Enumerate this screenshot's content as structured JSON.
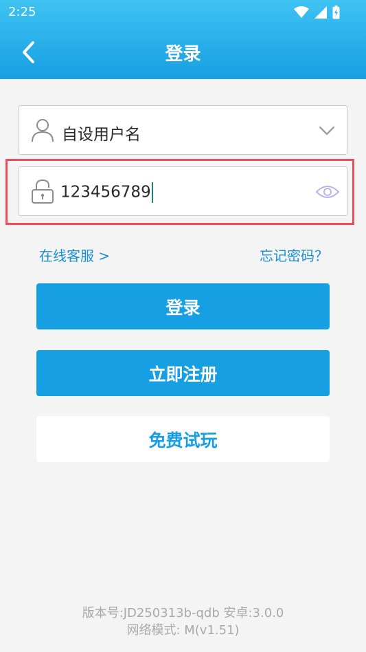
{
  "status_bar": {
    "time": "2:25"
  },
  "header": {
    "title": "登录"
  },
  "form": {
    "username": {
      "value": "自设用户名"
    },
    "password": {
      "value": "123456789"
    }
  },
  "links": {
    "service": "在线客服 >",
    "forgot": "忘记密码？"
  },
  "buttons": {
    "login": "登录",
    "register": "立即注册",
    "trial": "免费试玩"
  },
  "footer": {
    "version_line": "版本号:JD250313b-qdb  安卓:3.0.0",
    "network_line": "网络模式: M(v1.51)"
  },
  "colors": {
    "brand_blue": "#169fe3",
    "highlight_red": "#e8515b",
    "link_blue": "#1b8fd6"
  },
  "icons": [
    "back-icon",
    "user-icon",
    "lock-icon",
    "chevron-down-icon",
    "eye-icon",
    "wifi-icon",
    "signal-icon",
    "battery-icon"
  ]
}
